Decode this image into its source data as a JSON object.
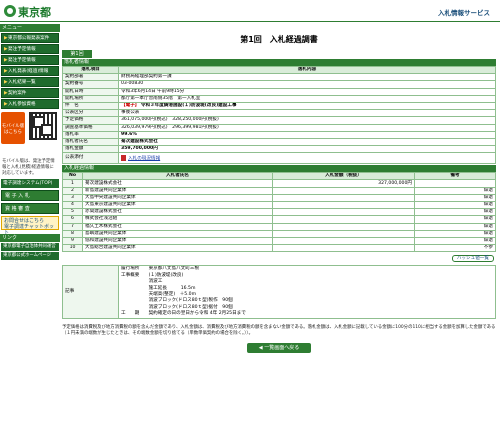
{
  "header": {
    "logo_text": "東京都",
    "site_name": "入札情報サービス"
  },
  "sidebar": {
    "menu_head": "メニュー",
    "items": [
      {
        "label": "東京都公報発表案件"
      },
      {
        "label": "発注予定情報"
      },
      {
        "label": "発注予定情報"
      },
      {
        "label": "入札発表(経過)情報"
      },
      {
        "label": "入札結果一覧"
      },
      {
        "label": "契約案件"
      },
      {
        "label": "入札参加資格"
      }
    ],
    "mobile_label": "モバイル版",
    "mobile_sub": "はこちら",
    "mobile_note": "モバイル版は、発注予定情報と入札(見積)経過情報に対応しています。",
    "ebid_label": "電子調達システム(TOP)",
    "btn_denshi": "電 子 入 札",
    "btn_shikaku": "資 格 審 査",
    "chat_label": "お問合せはこちら",
    "chat_sub": "電子調達チャットボット",
    "link_head": "リンク",
    "links": [
      {
        "label": "東京都電子自治体共同運営"
      },
      {
        "label": "東京都公式ホームページ"
      }
    ]
  },
  "main": {
    "title": "第1回　入札経過調書",
    "round_tab": "第1回",
    "bid_info": {
      "section": "落札者情報",
      "col_item": "落札項目",
      "col_content": "落札内容",
      "rows": [
        {
          "label": "契約部署",
          "value": "財務局経理部契約第一課"
        },
        {
          "label": "契約番号",
          "value": "03-00830"
        },
        {
          "label": "開札日時",
          "value": "令和3年6月14日 午前9時15分"
        },
        {
          "label": "開札場所",
          "value": "都庁第一本庁舎南側35階　第一入札室"
        },
        {
          "label": "件　名",
          "tag": "【電子】",
          "value": "令和３年度鋳港施設(１)防波堤(改良)建設工事"
        },
        {
          "label": "公表区分",
          "value": "事後公表"
        },
        {
          "label": "予定価格",
          "value": "361,075,000円(税込)　328,250,000円(税抜)"
        },
        {
          "label": "調査基準価格",
          "value": "326,039,979円(税込)　296,399,981円(税抜)"
        },
        {
          "label": "落札率",
          "value": "99.6%"
        },
        {
          "label": "落札者氏名",
          "value": "菊次建設株式会社"
        },
        {
          "label": "落札金額",
          "value": "359,700,000円"
        },
        {
          "label": "公表添付",
          "value": "入札の現況情報"
        }
      ]
    },
    "bid_list": {
      "section": "入札経過情報",
      "col_no": "No",
      "col_name": "入札者氏名",
      "col_amount": "入札金額（税抜）",
      "col_note": "備考",
      "rows": [
        {
          "no": "1",
          "name": "菊次建設株式会社",
          "amount": "327,000,000円",
          "note": ""
        },
        {
          "no": "2",
          "name": "新島建設共同企業体",
          "amount": "",
          "note": "辞退"
        },
        {
          "no": "3",
          "name": "大島中央建設共同企業体",
          "amount": "",
          "note": "辞退"
        },
        {
          "no": "4",
          "name": "大島東京建設共同企業体",
          "amount": "",
          "note": "辞退"
        },
        {
          "no": "5",
          "name": "赤間建設株式会社",
          "amount": "",
          "note": "辞退"
        },
        {
          "no": "6",
          "name": "株式会社浅沼組",
          "amount": "",
          "note": "辞退"
        },
        {
          "no": "7",
          "name": "福久土木株式会社",
          "amount": "",
          "note": "辞退"
        },
        {
          "no": "8",
          "name": "島嶼建設共同企業体",
          "amount": "",
          "note": "辞退"
        },
        {
          "no": "9",
          "name": "協和建設共同企業体",
          "amount": "",
          "note": "辞退"
        },
        {
          "no": "10",
          "name": "大島総合建設共同企業体",
          "amount": "",
          "note": "不参"
        }
      ],
      "history_btn": "ハッシュ値一覧"
    },
    "remarks": {
      "label": "記事",
      "lines": [
        "履行場所　　東京都八丈島八丈町三根",
        "工事概要　　(１)防波堤(改良)",
        "　　　　　　消波工",
        "　　　　　　施工延長　　　16.5m",
        "　　　　　　天端高(整定)　＋5.0m",
        "　　　　　　消波ブロック(ドロス80ｔ型)製作　90個",
        "　　　　　　消波ブロック(ドロス80ｔ型)据付　90個",
        "工　　期　　契約確定の日の翌日から令和 4年 2月25日まで"
      ]
    },
    "note": "予定価格は消費税及び地方消費税の額を含んだ金額であり、入札金額は、消費税及び地方消費税の額を含まない金額である。落札金額は、入札金額に記載している金額に100分の110に相当する金額を加算した金額である（１円未満の端数が生じたときは、その端数金額を切り捨てる（単数単価契約の場合を除く。））。",
    "back_btn": "一覧画面へ戻る"
  }
}
